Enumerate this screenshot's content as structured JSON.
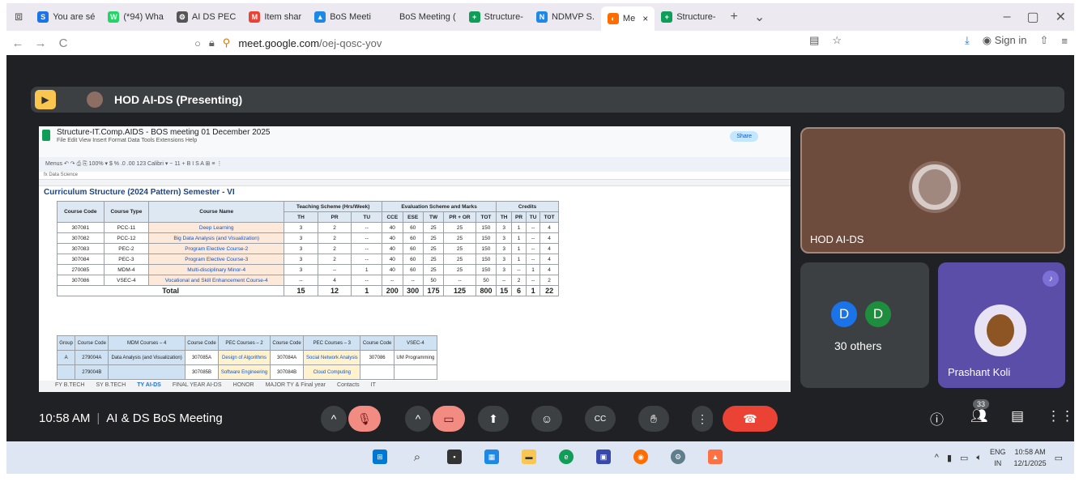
{
  "browser": {
    "tabs": [
      {
        "label": "You are sé",
        "favicon": "S",
        "color": "#1a73e8"
      },
      {
        "label": "(*94) Wha",
        "favicon": "W",
        "color": "#25d366"
      },
      {
        "label": "AI DS PEC",
        "favicon": "⚙",
        "color": "#555555"
      },
      {
        "label": "Item shar",
        "favicon": "M",
        "color": "#ea4335"
      },
      {
        "label": "BoS Meeti",
        "favicon": "▲",
        "color": "#1e88e5"
      },
      {
        "label": "BoS Meeting (",
        "favicon": "",
        "color": "#eceaf0"
      },
      {
        "label": "Structure-",
        "favicon": "+",
        "color": "#0f9d58"
      },
      {
        "label": "NDMVP S.",
        "favicon": "N",
        "color": "#1e88e5"
      },
      {
        "label": "Me",
        "favicon": "◐",
        "color": "#ff6d00",
        "active": true,
        "close": "×"
      },
      {
        "label": "Structure-",
        "favicon": "+",
        "color": "#0f9d58"
      }
    ],
    "new_tab": "+",
    "tab_list": "⌄",
    "win_min": "–",
    "win_max": "▢",
    "win_close": "✕",
    "back": "←",
    "forward": "→",
    "reload": "C",
    "url_host": "meet.google.com",
    "url_path": "/oej-qosc-yov",
    "sign_in": "Sign in"
  },
  "meet": {
    "presenting_title": "HOD AI-DS (Presenting)",
    "sheet": {
      "doc_title": "Structure-IT.Comp.AIDS - BOS meeting 01 December 2025",
      "menu": "File  Edit  View  Insert  Format  Data  Tools  Extensions  Help",
      "tools": "Menus   ↶  ↷  ⎙  ⎘  100%  ▾   $  %  .0  .00  123  Calibri  ▾  −  11  +   B  I  S  A   ⊞  ≡  ⋮",
      "formula": "fx   Data Science",
      "share": "Share",
      "banner": "Curriculum Structure (2024 Pattern) Semester - VI",
      "headers": {
        "course_code": "Course Code",
        "course_type": "Course Type",
        "course_name": "Course Name",
        "teaching": "Teaching Scheme (Hrs/Week)",
        "evaluation": "Evaluation Scheme and Marks",
        "credits": "Credits",
        "teach_cols": [
          "TH",
          "PR",
          "TU"
        ],
        "eval_cols": [
          "CCE",
          "ESE",
          "TW",
          "PR + OR",
          "TOT"
        ],
        "credit_cols": [
          "TH",
          "PR",
          "TU",
          "TOT"
        ]
      },
      "rows": [
        {
          "code": "307081",
          "type": "PCC-11",
          "name": "Deep Learning",
          "teach": [
            "3",
            "2",
            "--"
          ],
          "eval": [
            "40",
            "60",
            "25",
            "25",
            "150"
          ],
          "credits": [
            "3",
            "1",
            "--",
            "4"
          ]
        },
        {
          "code": "307082",
          "type": "PCC-12",
          "name": "Big Data Analysis (and Visualization)",
          "teach": [
            "3",
            "2",
            "--"
          ],
          "eval": [
            "40",
            "60",
            "25",
            "25",
            "150"
          ],
          "credits": [
            "3",
            "1",
            "--",
            "4"
          ]
        },
        {
          "code": "307083",
          "type": "PEC-2",
          "name": "Program Elective Course-2",
          "teach": [
            "3",
            "2",
            "--"
          ],
          "eval": [
            "40",
            "60",
            "25",
            "25",
            "150"
          ],
          "credits": [
            "3",
            "1",
            "--",
            "4"
          ]
        },
        {
          "code": "307084",
          "type": "PEC-3",
          "name": "Program Elective Course-3",
          "teach": [
            "3",
            "2",
            "--"
          ],
          "eval": [
            "40",
            "60",
            "25",
            "25",
            "150"
          ],
          "credits": [
            "3",
            "1",
            "--",
            "4"
          ]
        },
        {
          "code": "270085",
          "type": "MDM-4",
          "name": "Multi-disciplinary Minor-4",
          "teach": [
            "3",
            "--",
            "1"
          ],
          "eval": [
            "40",
            "60",
            "25",
            "25",
            "150"
          ],
          "credits": [
            "3",
            "--",
            "1",
            "4"
          ]
        },
        {
          "code": "307086",
          "type": "VSEC-4",
          "name": "Vocational and Skill Enhancement Course-4",
          "teach": [
            "--",
            "4",
            "--"
          ],
          "eval": [
            "--",
            "--",
            "50",
            "--",
            "50"
          ],
          "credits": [
            "--",
            "2",
            "--",
            "2"
          ]
        }
      ],
      "total": {
        "label": "Total",
        "values": [
          "15",
          "12",
          "1",
          "200",
          "300",
          "175",
          "125",
          "800",
          "15",
          "6",
          "1",
          "22"
        ]
      },
      "group": {
        "headers": [
          "Group",
          "Course Code",
          "MDM Courses – 4",
          "Course Code",
          "PEC Courses – 2",
          "Course Code",
          "PEC Courses – 3",
          "Course Code",
          "VSEC-4"
        ],
        "rows": [
          [
            "A",
            "279004A",
            "Data Analysis (and Visualization)",
            "307085A",
            "Design of Algorithms",
            "307084A",
            "Social Network Analysis",
            "307086",
            "UM Programming"
          ],
          [
            "",
            "279004B",
            "",
            "307085B",
            "Software Engineering",
            "307084B",
            "Cloud Computing",
            "",
            ""
          ]
        ]
      },
      "sheet_tabs": [
        "FY B.TECH",
        "SY B.TECH",
        "TY AI-DS",
        "FINAL YEAR AI-DS",
        "HONOR",
        "MAJOR TY & Final year",
        "Contacts",
        "IT"
      ]
    },
    "participants": {
      "featured": "HOD AI-DS",
      "others_initials": [
        "D",
        "D"
      ],
      "others_colors": [
        "#1a73e8",
        "#1e8e3e"
      ],
      "others_label": "30 others",
      "pinned": "Prashant Koli"
    },
    "controls": {
      "time": "10:58 AM",
      "meeting_name": "AI & DS BoS Meeting",
      "people_count": "33"
    }
  },
  "taskbar": {
    "lang_top": "ENG",
    "lang_bottom": "IN",
    "clock_time": "10:58 AM",
    "clock_date": "12/1/2025"
  }
}
